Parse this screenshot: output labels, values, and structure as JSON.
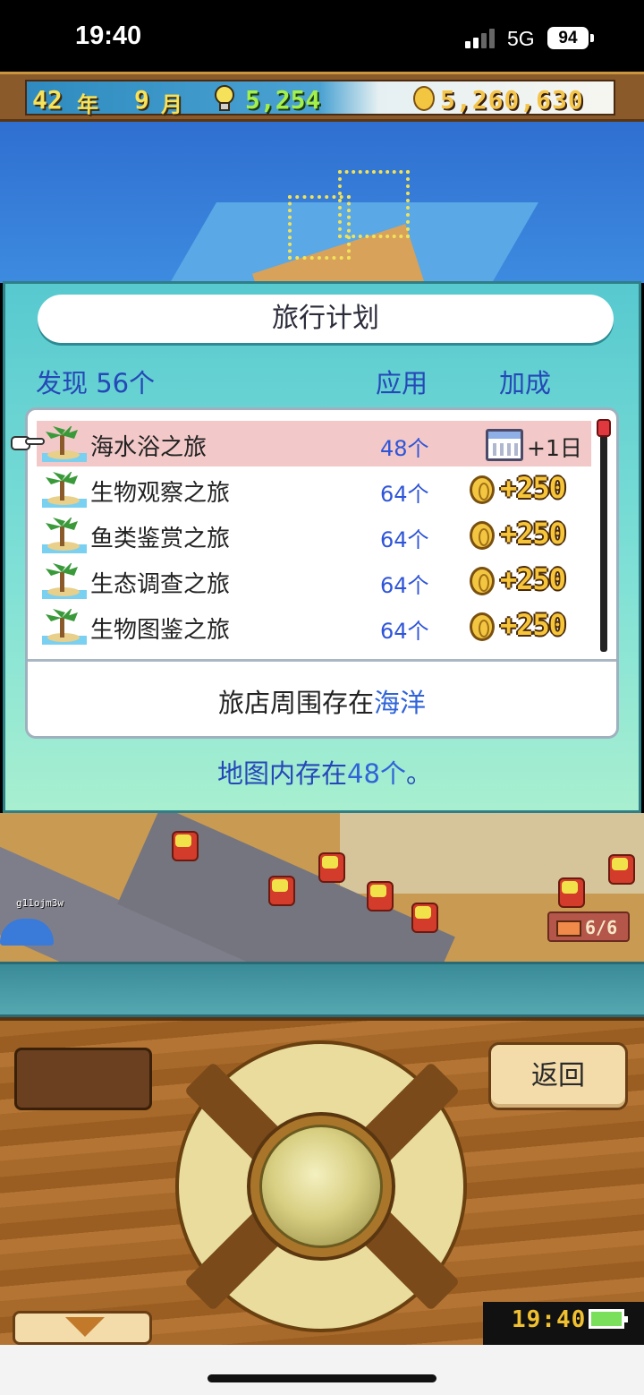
{
  "status_bar": {
    "time": "19:40",
    "network": "5G",
    "battery": "94"
  },
  "hud": {
    "year": "42",
    "year_unit": "年",
    "month": "9",
    "month_unit": "月",
    "ideas": "5,254",
    "money": "5,260,630"
  },
  "dialog": {
    "title": "旅行计划",
    "found_label": "发现 56个",
    "col_apply": "应用",
    "col_bonus": "加成",
    "items": [
      {
        "name": "海水浴之旅",
        "count": "48个",
        "bonus": "+1日",
        "bonus_icon": "calendar-icon",
        "selected": true
      },
      {
        "name": "生物观察之旅",
        "count": "64个",
        "bonus": "+250",
        "bonus_icon": "coin-icon"
      },
      {
        "name": "鱼类鉴赏之旅",
        "count": "64个",
        "bonus": "+250",
        "bonus_icon": "coin-icon"
      },
      {
        "name": "生态调查之旅",
        "count": "64个",
        "bonus": "+250",
        "bonus_icon": "coin-icon"
      },
      {
        "name": "生物图鉴之旅",
        "count": "64个",
        "bonus": "+250",
        "bonus_icon": "coin-icon"
      }
    ],
    "footer_prefix": "旅店周围存在",
    "footer_highlight": "海洋",
    "map_prefix": "地图内存在",
    "map_highlight": "48个",
    "map_suffix": "。"
  },
  "scene": {
    "player_tag": "g11ojm3w",
    "ticket_count": "6/6"
  },
  "controller": {
    "back_label": "返回",
    "clock": "19:40"
  },
  "colors": {
    "modal_bg": "#57c9cf",
    "accent_blue": "#2548b8",
    "coin_gold": "#f6c53a",
    "selected_row": "#f2c8c8"
  }
}
